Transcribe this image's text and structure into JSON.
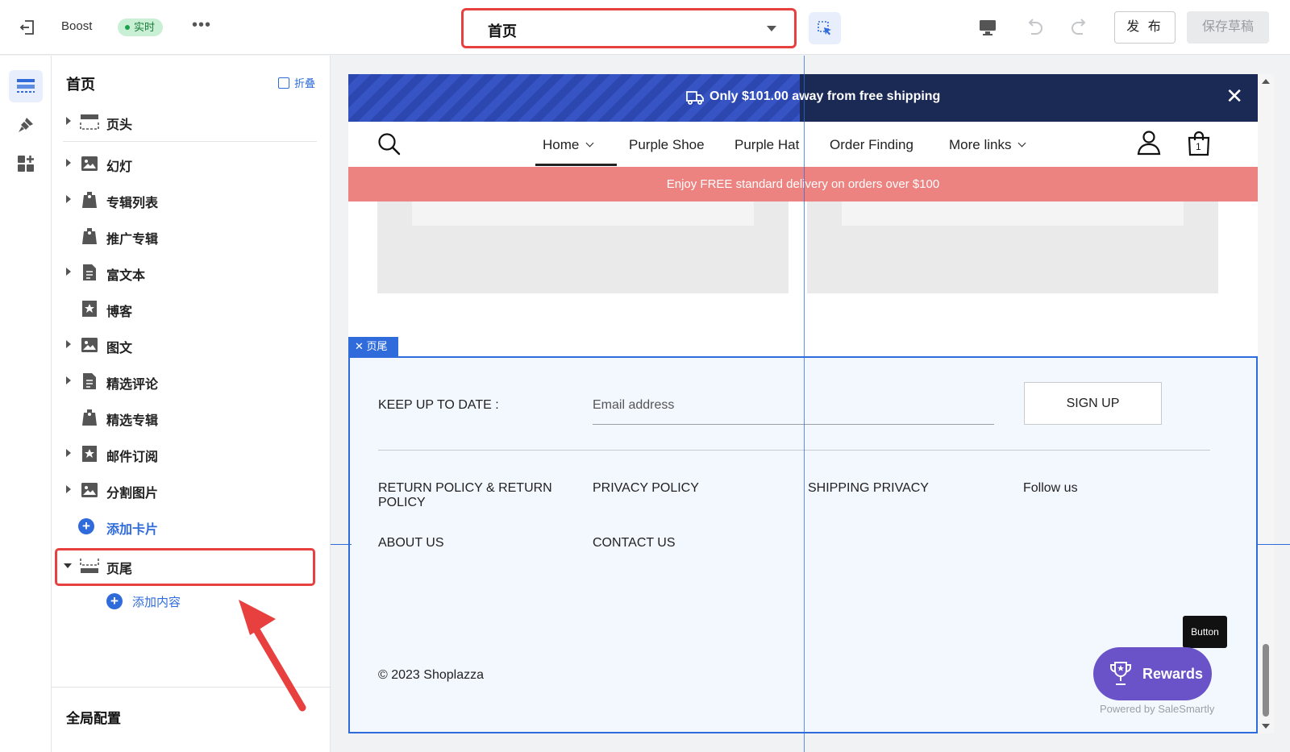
{
  "topbar": {
    "theme_name": "Boost",
    "live_badge": "实时",
    "more": "•••",
    "page_selector": "首页",
    "publish": "发 布",
    "save_draft": "保存草稿"
  },
  "sidebar": {
    "title": "首页",
    "collapse": "折叠",
    "items": [
      {
        "label": "页头",
        "icon": "header-layout-icon",
        "expandable": true
      },
      {
        "label": "幻灯",
        "icon": "image-icon",
        "expandable": true
      },
      {
        "label": "专辑列表",
        "icon": "tag-icon",
        "expandable": true
      },
      {
        "label": "推广专辑",
        "icon": "tag-icon",
        "expandable": false
      },
      {
        "label": "富文本",
        "icon": "document-icon",
        "expandable": true
      },
      {
        "label": "博客",
        "icon": "star-icon",
        "expandable": false
      },
      {
        "label": "图文",
        "icon": "image-icon",
        "expandable": true
      },
      {
        "label": "精选评论",
        "icon": "document-icon",
        "expandable": true
      },
      {
        "label": "精选专辑",
        "icon": "tag-icon",
        "expandable": false
      },
      {
        "label": "邮件订阅",
        "icon": "star-icon",
        "expandable": true
      },
      {
        "label": "分割图片",
        "icon": "image-icon",
        "expandable": true
      }
    ],
    "add_card": "添加卡片",
    "footer_item": "页尾",
    "add_content": "添加内容",
    "global_config": "全局配置"
  },
  "preview": {
    "announcement": "Only $101.00 away from free shipping",
    "nav": [
      "Home",
      "Purple Shoe",
      "Purple Hat",
      "Order Finding",
      "More links"
    ],
    "cart_count": "1",
    "promo": "Enjoy FREE standard delivery on orders over $100",
    "footer_tag": "页尾",
    "footer": {
      "keep_up": "KEEP UP TO DATE :",
      "email_placeholder": "Email address",
      "signup": "SIGN UP",
      "links": {
        "return_policy_1": "RETURN POLICY & RETURN",
        "return_policy_2": "POLICY",
        "privacy": "PRIVACY POLICY",
        "shipping": "SHIPPING PRIVACY",
        "follow": "Follow us",
        "about": "ABOUT US",
        "contact": "CONTACT US"
      },
      "copyright": "© 2023 Shoplazza",
      "tooltip": "Button",
      "rewards": "Rewards",
      "powered": "Powered by SaleSmartly"
    }
  },
  "colors": {
    "accent": "#2f6bdb",
    "highlight": "#e8403f",
    "announcement_bg": "#1b2a55",
    "promo_bg": "#ec8381",
    "rewards_bg": "#6a53c9"
  }
}
